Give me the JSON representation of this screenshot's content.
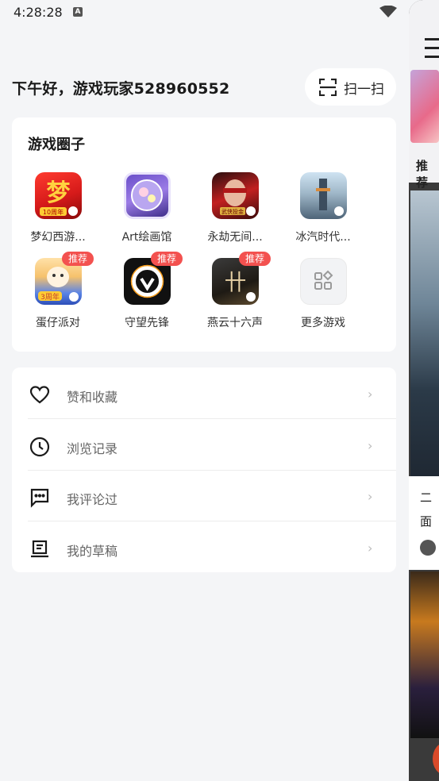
{
  "status_bar": {
    "time": "4:28:28",
    "a_badge": "A"
  },
  "header": {
    "greeting": "下午好，游戏玩家528960552",
    "scan_label": "扫一扫"
  },
  "games_section": {
    "title": "游戏圈子",
    "games": [
      {
        "name": "梦幻西游...",
        "badge": "",
        "icon": "menghuan-xiyou-icon"
      },
      {
        "name": "Art绘画馆",
        "badge": "",
        "icon": "art-gallery-icon"
      },
      {
        "name": "永劫无间...",
        "badge": "",
        "icon": "yongjie-wujian-icon"
      },
      {
        "name": "冰汽时代...",
        "badge": "",
        "icon": "frostpunk-icon"
      },
      {
        "name": "蛋仔派对",
        "badge": "推荐",
        "icon": "eggy-party-icon"
      },
      {
        "name": "守望先锋",
        "badge": "推荐",
        "icon": "overwatch-icon"
      },
      {
        "name": "燕云十六声",
        "badge": "推荐",
        "icon": "yanyun-icon"
      },
      {
        "name": "更多游戏",
        "badge": "",
        "icon": "more-games-icon"
      }
    ]
  },
  "menu": {
    "items": [
      {
        "label": "赞和收藏",
        "icon": "heart-icon"
      },
      {
        "label": "浏览记录",
        "icon": "clock-icon"
      },
      {
        "label": "我评论过",
        "icon": "comment-icon"
      },
      {
        "label": "我的草稿",
        "icon": "draft-icon"
      }
    ],
    "chevron": "›"
  },
  "background_peek": {
    "tab_label": "推荐",
    "card_line1": "二",
    "card_line2": "面"
  }
}
